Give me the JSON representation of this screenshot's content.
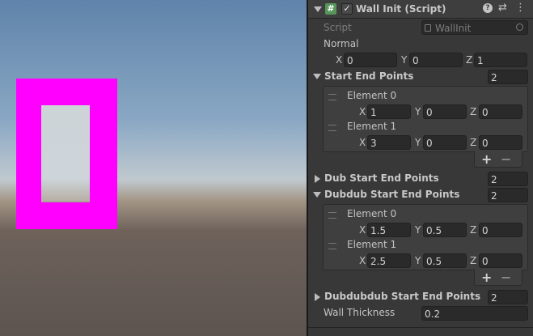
{
  "component": {
    "title": "Wall Init (Script)",
    "icon": "script-hash-icon",
    "enabled": true
  },
  "script": {
    "label": "Script",
    "value": "WallInit"
  },
  "normal": {
    "label": "Normal",
    "x": "0",
    "y": "0",
    "z": "1"
  },
  "axes": {
    "x": "X",
    "y": "Y",
    "z": "Z"
  },
  "start_end_points": {
    "label": "Start End Points",
    "size": "2",
    "elements": [
      {
        "label": "Element 0",
        "x": "1",
        "y": "0",
        "z": "0"
      },
      {
        "label": "Element 1",
        "x": "3",
        "y": "0",
        "z": "0"
      }
    ]
  },
  "dub_start_end_points": {
    "label": "Dub Start End Points",
    "size": "2"
  },
  "dubdub_start_end_points": {
    "label": "Dubdub Start End Points",
    "size": "2",
    "elements": [
      {
        "label": "Element 0",
        "x": "1.5",
        "y": "0.5",
        "z": "0"
      },
      {
        "label": "Element 1",
        "x": "2.5",
        "y": "0.5",
        "z": "0"
      }
    ]
  },
  "dubdubdub_start_end_points": {
    "label": "Dubdubdub Start End Points",
    "size": "2"
  },
  "wall_thickness": {
    "label": "Wall Thickness",
    "value": "0.2"
  },
  "list_buttons": {
    "add": "+",
    "remove": "−"
  },
  "colors": {
    "wall": "#ff00ff",
    "panel": "#383838",
    "field": "#2a2a2a"
  }
}
